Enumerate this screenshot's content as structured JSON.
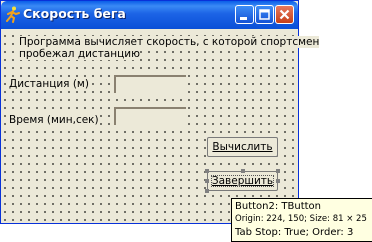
{
  "window": {
    "title": "Скорость бега",
    "buttons": [
      "minimize",
      "maximize",
      "close"
    ]
  },
  "form": {
    "description_line1": "Программа вычисляет скорость, с которой спортсмен",
    "description_line2": "пробежал дистанцию",
    "distance_label": "Дистанция (м)",
    "time_label": "Время (мин,сек)",
    "distance_value": "",
    "time_value": ""
  },
  "buttons": {
    "compute": "Вычислить",
    "finish": "Завершить"
  },
  "hint": {
    "line1": "Button2: TButton",
    "line2": "Origin: 224, 150; Size: 81 × 25",
    "line3": "Tab Stop: True; Order: 3"
  },
  "icons": {
    "app": "running-man-icon",
    "minimize": "minimize-icon",
    "maximize": "maximize-icon",
    "close": "close-icon"
  },
  "colors": {
    "titlebar": "#0a5de8",
    "form_background": "#ece9d8",
    "close_button": "#c63f18",
    "hint_background": "#ffffe1"
  }
}
